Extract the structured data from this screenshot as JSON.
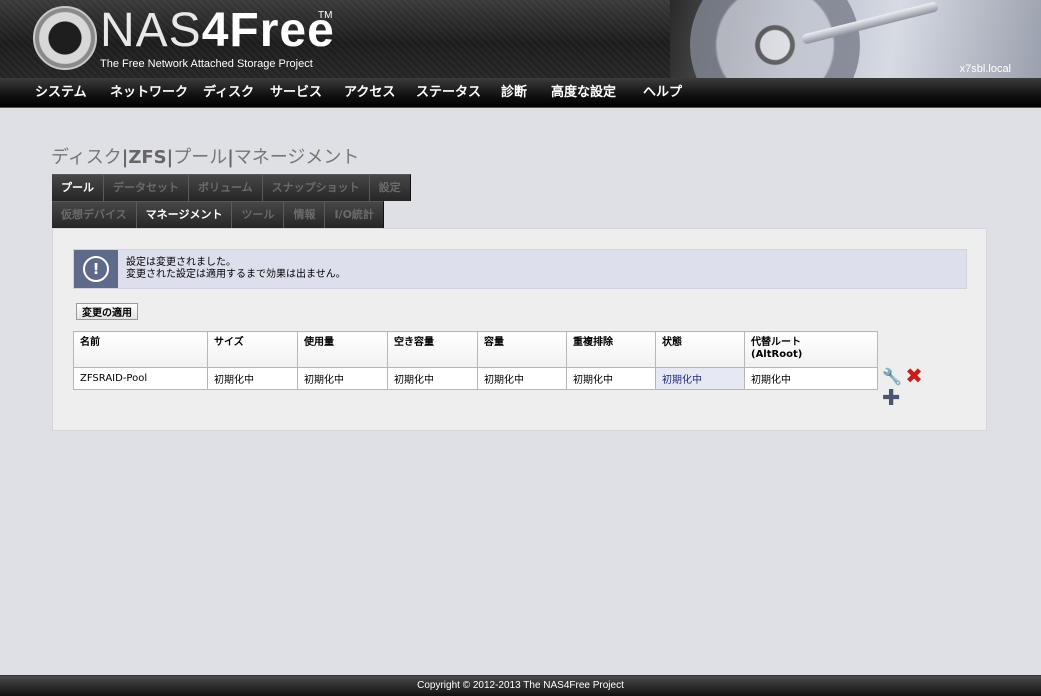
{
  "header": {
    "logo_main": "NAS",
    "logo_four": "4Free",
    "logo_tm": "TM",
    "tagline": "The Free Network Attached Storage Project",
    "hostname": "x7sbl.local"
  },
  "nav": {
    "items": [
      "システム",
      "ネットワーク",
      "ディスク",
      "サービス",
      "アクセス",
      "ステータス",
      "診断",
      "高度な設定",
      "ヘルプ"
    ]
  },
  "page": {
    "title_part1": "ディスク",
    "title_sep1": "|",
    "title_part2": "ZFS",
    "title_sep2": "|",
    "title_part3": "プール",
    "title_sep3": "|",
    "title_part4": "マネージメント"
  },
  "tabs": {
    "row1": [
      "プール",
      "データセット",
      "ボリューム",
      "スナップショット",
      "設定"
    ],
    "row2": [
      "仮想デバイス",
      "マネージメント",
      "ツール",
      "情報",
      "I/O統計"
    ]
  },
  "info": {
    "line1": "設定は変更されました。",
    "line2": "変更された設定は適用するまで効果は出ません。",
    "icon_glyph": "!"
  },
  "apply_button": "変更の適用",
  "table": {
    "headers": [
      "名前",
      "サイズ",
      "使用量",
      "空き容量",
      "容量",
      "重複排除",
      "状態",
      "代替ルート",
      "(AltRoot)"
    ],
    "row": [
      "ZFSRAID-Pool",
      "初期化中",
      "初期化中",
      "初期化中",
      "初期化中",
      "初期化中",
      "初期化中",
      "初期化中"
    ]
  },
  "icons": {
    "edit": "wrench-icon",
    "delete": "delete-x-icon",
    "add": "add-plus-icon"
  },
  "footer": {
    "copyright": "Copyright © 2012-2013 The NAS4Free Project"
  }
}
